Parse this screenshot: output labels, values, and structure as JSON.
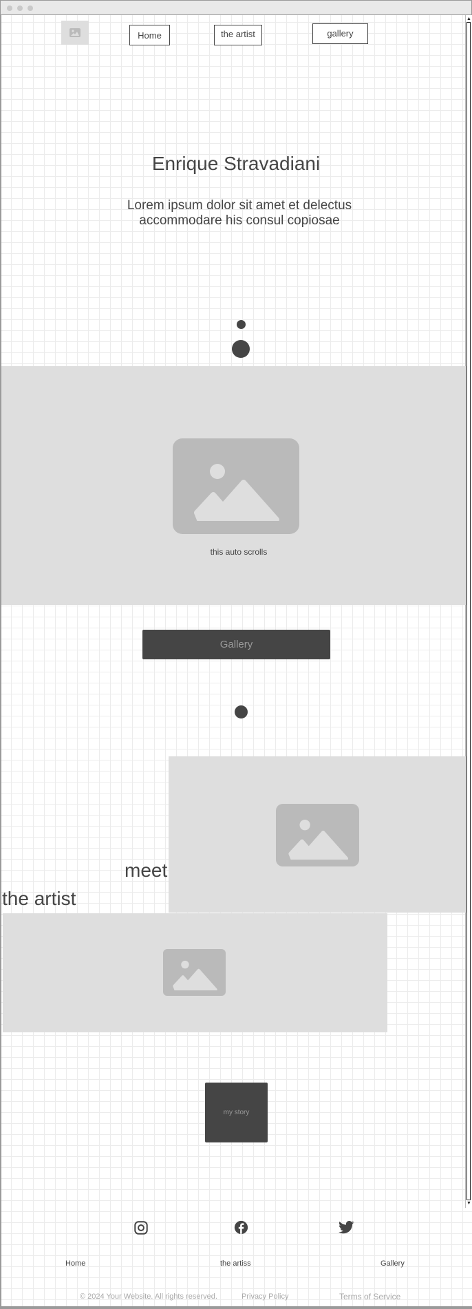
{
  "nav": {
    "home_label": "Home",
    "artist_label": "the artist",
    "gallery_label": "gallery"
  },
  "hero": {
    "title": "Enrique Stravadiani",
    "subtitle": "Lorem ipsum dolor sit amet et delectus accommodare his consul copiosae"
  },
  "carousel": {
    "caption": "this auto scrolls"
  },
  "gallery_button": {
    "label": "Gallery"
  },
  "meet": {
    "word1": "meet",
    "word2": "the artist"
  },
  "story_button": {
    "label": "my story"
  },
  "footer": {
    "social": [
      "instagram-icon",
      "facebook-icon",
      "twitter-icon"
    ],
    "links": [
      "Home",
      "the artiss",
      "Gallery"
    ],
    "copyright": "© 2024 Your Website. All rights reserved.",
    "privacy": "Privacy Policy",
    "terms": "Terms of Service"
  },
  "colors": {
    "dark": "#454545",
    "placeholder_bg": "#dedede",
    "placeholder_icon": "#bababa",
    "grid": "#ececec"
  }
}
